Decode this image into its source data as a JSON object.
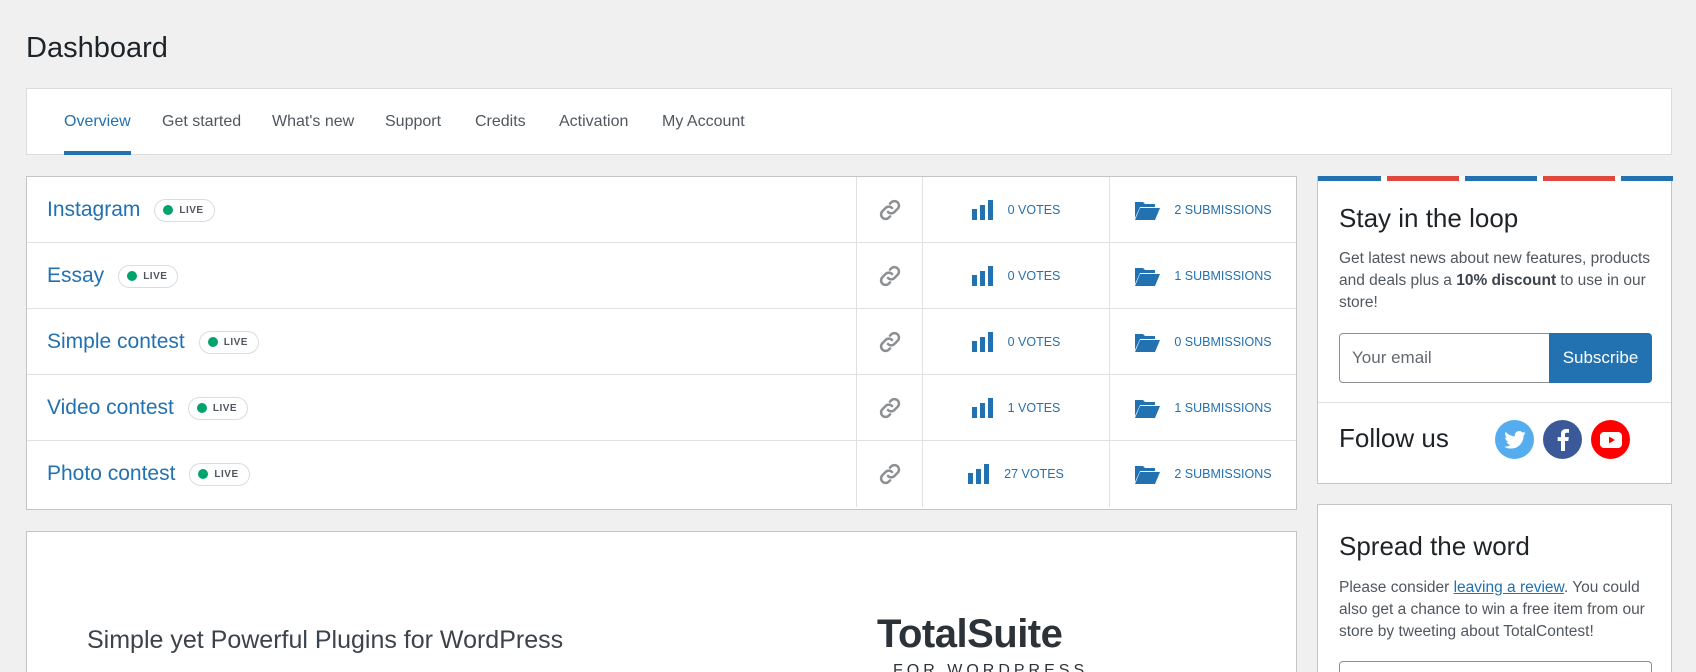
{
  "page": {
    "title": "Dashboard"
  },
  "tabs": [
    {
      "label": "Overview",
      "active": true
    },
    {
      "label": "Get started"
    },
    {
      "label": "What's new"
    },
    {
      "label": "Support"
    },
    {
      "label": "Credits"
    },
    {
      "label": "Activation"
    },
    {
      "label": "My Account"
    }
  ],
  "contests": [
    {
      "name": "Instagram",
      "status": "LIVE",
      "votes": "0 VOTES",
      "submissions": "2 SUBMISSIONS"
    },
    {
      "name": "Essay",
      "status": "LIVE",
      "votes": "0 VOTES",
      "submissions": "1 SUBMISSIONS"
    },
    {
      "name": "Simple contest",
      "status": "LIVE",
      "votes": "0 VOTES",
      "submissions": "0 SUBMISSIONS"
    },
    {
      "name": "Video contest",
      "status": "LIVE",
      "votes": "1 VOTES",
      "submissions": "1 SUBMISSIONS"
    },
    {
      "name": "Photo contest",
      "status": "LIVE",
      "votes": "27 VOTES",
      "submissions": "2 SUBMISSIONS"
    }
  ],
  "promo": {
    "tagline": "Simple yet Powerful Plugins for WordPress",
    "logo": "TotalSuite",
    "logo_sub": "FOR WORDPRESS"
  },
  "newsletter": {
    "title": "Stay in the loop",
    "desc_before": "Get latest news about new features, products and deals plus a ",
    "desc_bold": "10% discount",
    "desc_after": " to use in our store!",
    "email_placeholder": "Your email",
    "subscribe_label": "Subscribe",
    "stripe_colors": [
      "#2271b1",
      "#e0483e",
      "#2271b1",
      "#e0483e",
      "#2271b1"
    ]
  },
  "follow": {
    "label": "Follow us",
    "networks": [
      {
        "name": "twitter",
        "color": "#55acee"
      },
      {
        "name": "facebook",
        "color": "#3b5998"
      },
      {
        "name": "youtube",
        "color": "#ff0000"
      }
    ]
  },
  "spread": {
    "title": "Spread the word",
    "desc_before": "Please consider ",
    "link": "leaving a review",
    "desc_after": ". You could also get a chance to win a free item from our store by tweeting about TotalContest!"
  },
  "colors": {
    "accent": "#2271b1",
    "live": "#00a36c",
    "background": "#f0f0f1"
  }
}
